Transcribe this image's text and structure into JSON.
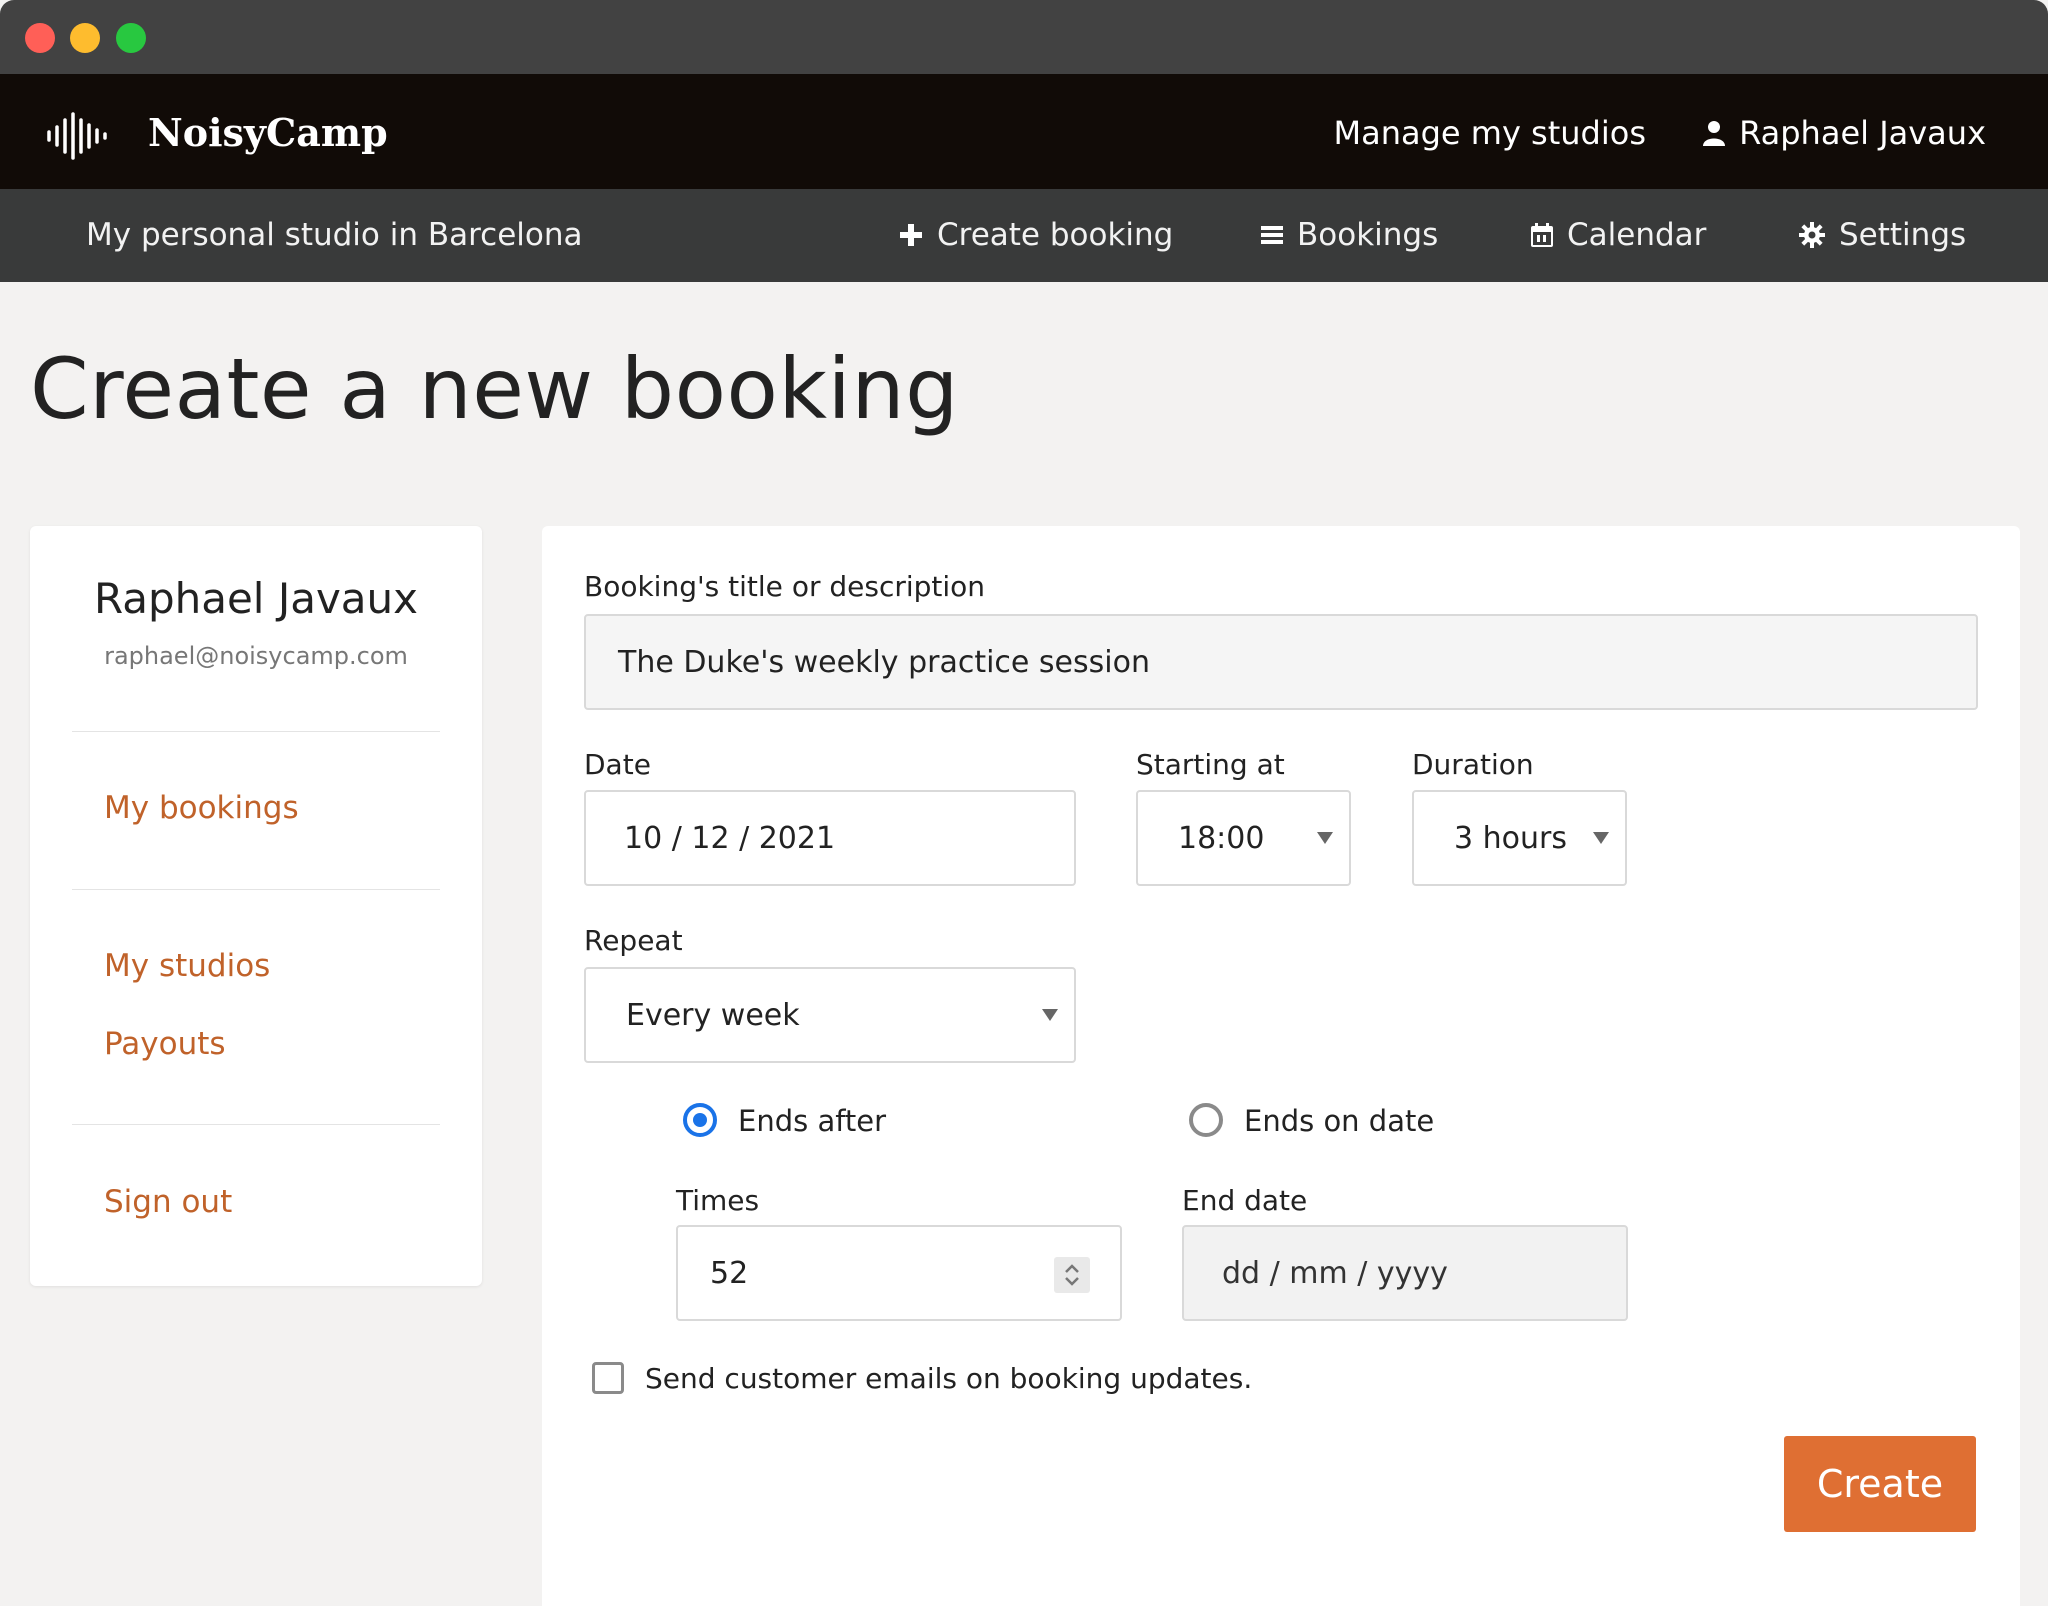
{
  "app": {
    "brand": "NoisyCamp"
  },
  "topnav": {
    "manage_label": "Manage my studios",
    "user_name": "Raphael Javaux"
  },
  "subnav": {
    "studio_name": "My personal studio in Barcelona",
    "items": [
      {
        "label": "Create booking",
        "icon": "plus-icon"
      },
      {
        "label": "Bookings",
        "icon": "list-icon"
      },
      {
        "label": "Calendar",
        "icon": "calendar-icon"
      },
      {
        "label": "Settings",
        "icon": "gear-icon"
      }
    ]
  },
  "page": {
    "title": "Create a new booking"
  },
  "sidebar": {
    "name": "Raphael Javaux",
    "email": "raphael@noisycamp.com",
    "links": {
      "my_bookings": "My bookings",
      "my_studios": "My studios",
      "payouts": "Payouts",
      "sign_out": "Sign out"
    },
    "link_color": "#c0622a"
  },
  "form": {
    "title_label": "Booking's title or description",
    "title_value": "The Duke's  weekly practice session",
    "date_label": "Date",
    "date_value": "10 / 12 / 2021",
    "start_label": "Starting at",
    "start_value": "18:00",
    "duration_label": "Duration",
    "duration_value": "3 hours",
    "repeat_label": "Repeat",
    "repeat_value": "Every week",
    "ends_after_label": "Ends after",
    "ends_after_selected": true,
    "ends_on_date_label": "Ends on date",
    "times_label": "Times",
    "times_value": "52",
    "end_date_label": "End date",
    "end_date_placeholder": "dd / mm / yyyy",
    "email_check_label": "Send customer emails on booking updates.",
    "email_check_checked": false,
    "submit_label": "Create",
    "submit_color": "#df6f33",
    "radio_color": "#1a73e8"
  }
}
